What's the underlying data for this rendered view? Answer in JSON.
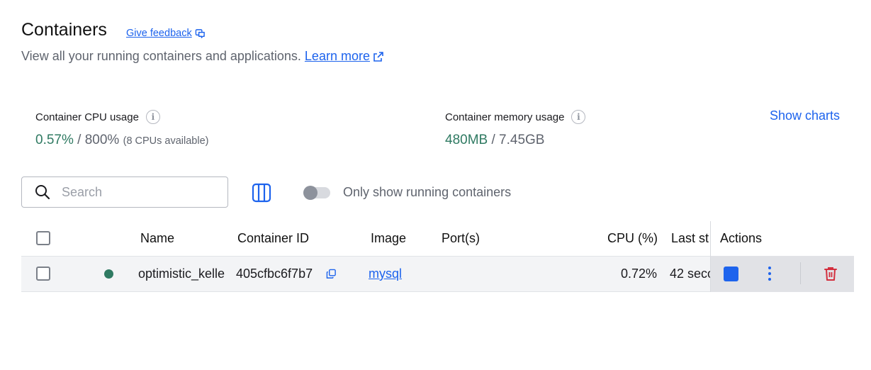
{
  "header": {
    "title": "Containers",
    "feedback_label": "Give feedback",
    "subtitle": "View all your running containers and applications.",
    "learn_more": "Learn more"
  },
  "stats": {
    "cpu": {
      "label": "Container CPU usage",
      "used": "0.57%",
      "separator": " / ",
      "total": "800%",
      "note": "(8 CPUs available)"
    },
    "memory": {
      "label": "Container memory usage",
      "used": "480MB",
      "separator": " / ",
      "total": "7.45GB"
    },
    "show_charts": "Show charts"
  },
  "toolbar": {
    "search_placeholder": "Search",
    "toggle_label": "Only show running containers",
    "toggle_on": false
  },
  "table": {
    "columns": {
      "name": "Name",
      "container_id": "Container ID",
      "image": "Image",
      "ports": "Port(s)",
      "cpu": "CPU (%)",
      "last_started": "Last st",
      "actions": "Actions"
    },
    "rows": [
      {
        "status": "running",
        "name": "optimistic_kelle",
        "container_id": "405cfbc6f7b7",
        "image": "mysql",
        "ports": "",
        "cpu": "0.72%",
        "last_started": "42 seco"
      }
    ]
  },
  "colors": {
    "accent": "#1d63ed",
    "running": "#2f7a62",
    "danger": "#d32f3e"
  },
  "icons": {
    "feedback": "feedback-icon",
    "external_link": "external-link-icon",
    "info": "info-icon",
    "search": "search-icon",
    "columns": "columns-icon",
    "copy": "copy-icon",
    "stop": "stop-icon",
    "more": "kebab-menu-icon",
    "delete": "trash-icon"
  }
}
